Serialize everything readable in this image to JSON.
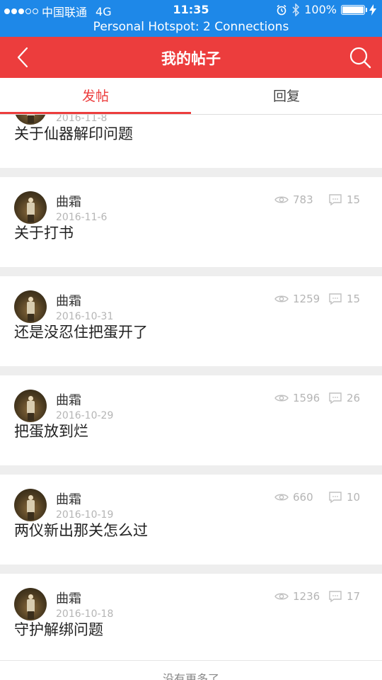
{
  "status_bar": {
    "carrier": "中国联通",
    "network": "4G",
    "time": "11:35",
    "battery": "100%",
    "battery_level": 1.0,
    "signal_bars": 3,
    "hotspot": "Personal Hotspot: 2 Connections"
  },
  "nav": {
    "title": "我的帖子",
    "back_icon": "chevron-left-icon",
    "search_icon": "search-icon"
  },
  "tabs": [
    {
      "label": "发帖",
      "active": true
    },
    {
      "label": "回复",
      "active": false
    }
  ],
  "posts": [
    {
      "author": "",
      "date": "2016-11-8",
      "views": "",
      "replies": "",
      "title": "关于仙器解印问题"
    },
    {
      "author": "曲霜",
      "date": "2016-11-6",
      "views": "783",
      "replies": "15",
      "title": "关于打书"
    },
    {
      "author": "曲霜",
      "date": "2016-10-31",
      "views": "1259",
      "replies": "15",
      "title": "还是没忍住把蛋开了"
    },
    {
      "author": "曲霜",
      "date": "2016-10-29",
      "views": "1596",
      "replies": "26",
      "title": "把蛋放到烂"
    },
    {
      "author": "曲霜",
      "date": "2016-10-19",
      "views": "660",
      "replies": "10",
      "title": "两仪新出那关怎么过"
    },
    {
      "author": "曲霜",
      "date": "2016-10-18",
      "views": "1236",
      "replies": "17",
      "title": "守护解绑问题"
    }
  ],
  "footer": {
    "text": "没有更多了"
  },
  "colors": {
    "accent": "#ec3d3d",
    "status_bar": "#1e88e8"
  }
}
